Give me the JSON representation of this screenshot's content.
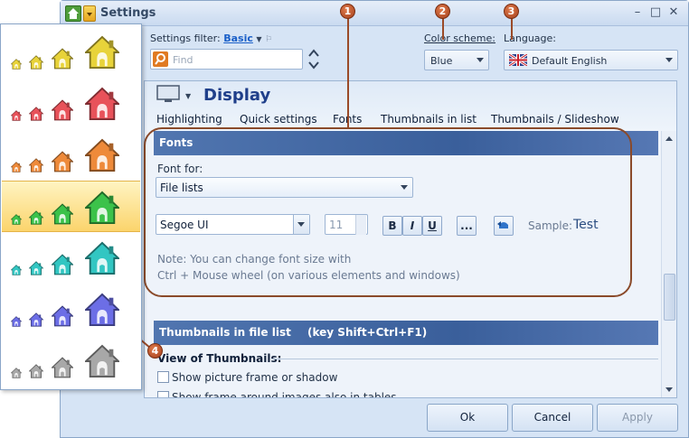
{
  "window": {
    "title": "Settings"
  },
  "header": {
    "filter_label": "Settings filter:",
    "filter_value": "Basic",
    "search_placeholder": "Find",
    "color_scheme_label": "Color scheme:",
    "color_scheme_value": "Blue",
    "language_label": "Language:",
    "language_value": "Default English"
  },
  "panel": {
    "title": "Display",
    "tabs": [
      "Highlighting",
      "Quick settings",
      "Fonts",
      "Thumbnails in list",
      "Thumbnails / Slideshow"
    ],
    "fonts_section": {
      "heading": "Fonts",
      "font_for_label": "Font for:",
      "font_for_value": "File lists",
      "font_name": "Segoe UI",
      "font_size": "11",
      "bold_label": "B",
      "italic_label": "I",
      "underline_label": "U",
      "more_label": "...",
      "sample_label": "Sample:",
      "sample_text": "Test",
      "note_line1": "Note: You can change font size with",
      "note_line2": "Ctrl + Mouse wheel (on various elements and windows)"
    },
    "thumbs_section": {
      "heading": "Thumbnails in file list",
      "heading_key": "(key Shift+Ctrl+F1)",
      "subheading": "View of Thumbnails:",
      "option1": "Show picture frame or shadow",
      "option2": "Show frame around images also in tables"
    }
  },
  "footer": {
    "ok": "Ok",
    "cancel": "Cancel",
    "apply": "Apply"
  },
  "callouts": [
    "1",
    "2",
    "3",
    "4"
  ],
  "palette": {
    "themes": [
      {
        "color": "#e8d33a",
        "selected": false
      },
      {
        "color": "#e8525a",
        "selected": false
      },
      {
        "color": "#ee8a3a",
        "selected": false
      },
      {
        "color": "#3cc24a",
        "selected": true
      },
      {
        "color": "#32c6c2",
        "selected": false
      },
      {
        "color": "#6c6ee6",
        "selected": false
      },
      {
        "color": "#a8a8a8",
        "selected": false
      }
    ]
  },
  "colors": {
    "accent": "#1f3f8a",
    "highlight_ring": "#8a4a2a",
    "callout": "#a4401c"
  }
}
